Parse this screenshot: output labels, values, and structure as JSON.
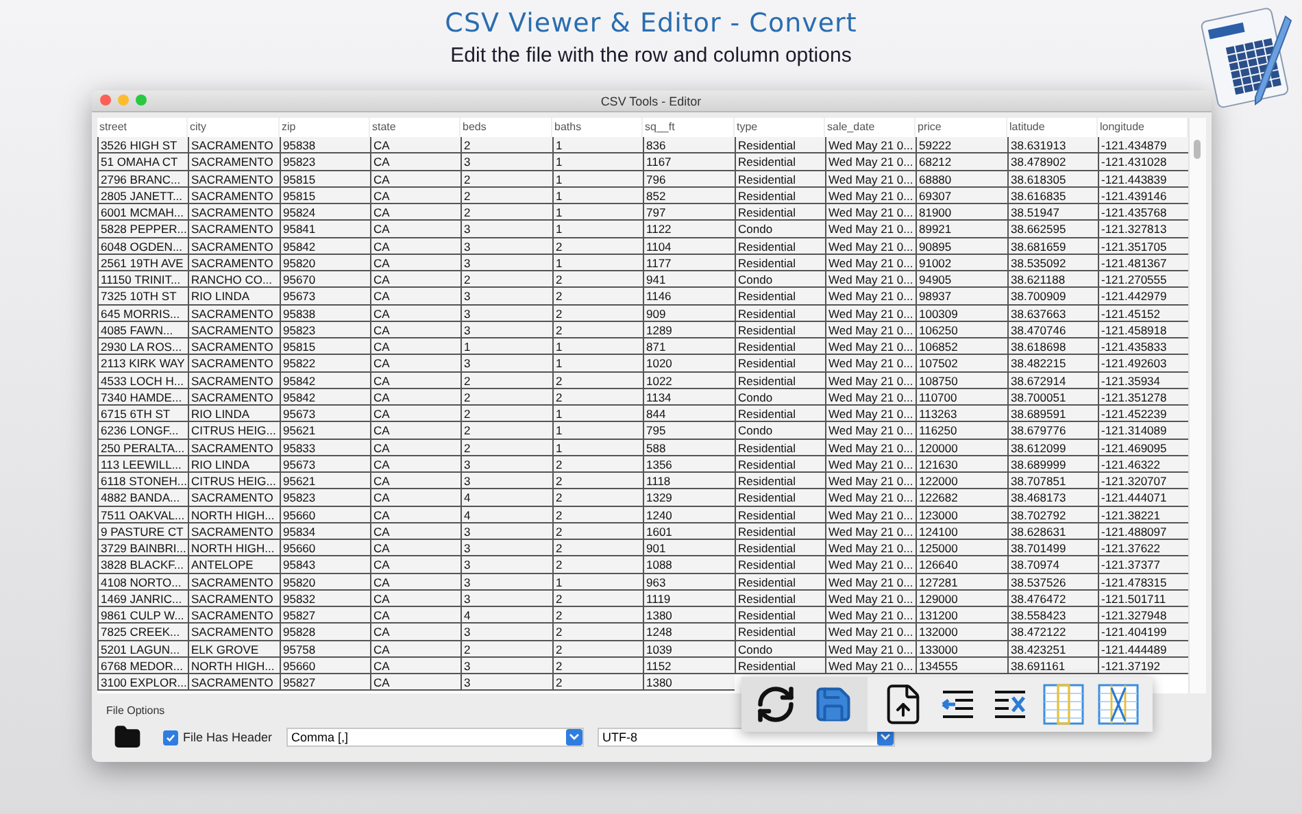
{
  "banner": {
    "title": "CSV Viewer & Editor - Convert",
    "subtitle": "Edit the file with the row and column options"
  },
  "window": {
    "title": "CSV Tools - Editor"
  },
  "table": {
    "columns": [
      "street",
      "city",
      "zip",
      "state",
      "beds",
      "baths",
      "sq__ft",
      "type",
      "sale_date",
      "price",
      "latitude",
      "longitude"
    ],
    "rows": [
      [
        "3526 HIGH ST",
        "SACRAMENTO",
        "95838",
        "CA",
        "2",
        "1",
        "836",
        "Residential",
        "Wed May 21 0...",
        "59222",
        "38.631913",
        "-121.434879"
      ],
      [
        "51 OMAHA CT",
        "SACRAMENTO",
        "95823",
        "CA",
        "3",
        "1",
        "1167",
        "Residential",
        "Wed May 21 0...",
        "68212",
        "38.478902",
        "-121.431028"
      ],
      [
        "2796 BRANC...",
        "SACRAMENTO",
        "95815",
        "CA",
        "2",
        "1",
        "796",
        "Residential",
        "Wed May 21 0...",
        "68880",
        "38.618305",
        "-121.443839"
      ],
      [
        "2805 JANETT...",
        "SACRAMENTO",
        "95815",
        "CA",
        "2",
        "1",
        "852",
        "Residential",
        "Wed May 21 0...",
        "69307",
        "38.616835",
        "-121.439146"
      ],
      [
        "6001 MCMAH...",
        "SACRAMENTO",
        "95824",
        "CA",
        "2",
        "1",
        "797",
        "Residential",
        "Wed May 21 0...",
        "81900",
        "38.51947",
        "-121.435768"
      ],
      [
        "5828 PEPPER...",
        "SACRAMENTO",
        "95841",
        "CA",
        "3",
        "1",
        "1122",
        "Condo",
        "Wed May 21 0...",
        "89921",
        "38.662595",
        "-121.327813"
      ],
      [
        "6048 OGDEN...",
        "SACRAMENTO",
        "95842",
        "CA",
        "3",
        "2",
        "1104",
        "Residential",
        "Wed May 21 0...",
        "90895",
        "38.681659",
        "-121.351705"
      ],
      [
        "2561 19TH AVE",
        "SACRAMENTO",
        "95820",
        "CA",
        "3",
        "1",
        "1177",
        "Residential",
        "Wed May 21 0...",
        "91002",
        "38.535092",
        "-121.481367"
      ],
      [
        "11150 TRINIT...",
        "RANCHO CO...",
        "95670",
        "CA",
        "2",
        "2",
        "941",
        "Condo",
        "Wed May 21 0...",
        "94905",
        "38.621188",
        "-121.270555"
      ],
      [
        "7325 10TH ST",
        "RIO LINDA",
        "95673",
        "CA",
        "3",
        "2",
        "1146",
        "Residential",
        "Wed May 21 0...",
        "98937",
        "38.700909",
        "-121.442979"
      ],
      [
        "645 MORRIS...",
        "SACRAMENTO",
        "95838",
        "CA",
        "3",
        "2",
        "909",
        "Residential",
        "Wed May 21 0...",
        "100309",
        "38.637663",
        "-121.45152"
      ],
      [
        "4085 FAWN...",
        "SACRAMENTO",
        "95823",
        "CA",
        "3",
        "2",
        "1289",
        "Residential",
        "Wed May 21 0...",
        "106250",
        "38.470746",
        "-121.458918"
      ],
      [
        "2930 LA ROS...",
        "SACRAMENTO",
        "95815",
        "CA",
        "1",
        "1",
        "871",
        "Residential",
        "Wed May 21 0...",
        "106852",
        "38.618698",
        "-121.435833"
      ],
      [
        "2113 KIRK WAY",
        "SACRAMENTO",
        "95822",
        "CA",
        "3",
        "1",
        "1020",
        "Residential",
        "Wed May 21 0...",
        "107502",
        "38.482215",
        "-121.492603"
      ],
      [
        "4533 LOCH H...",
        "SACRAMENTO",
        "95842",
        "CA",
        "2",
        "2",
        "1022",
        "Residential",
        "Wed May 21 0...",
        "108750",
        "38.672914",
        "-121.35934"
      ],
      [
        "7340 HAMDE...",
        "SACRAMENTO",
        "95842",
        "CA",
        "2",
        "2",
        "1134",
        "Condo",
        "Wed May 21 0...",
        "110700",
        "38.700051",
        "-121.351278"
      ],
      [
        "6715 6TH ST",
        "RIO LINDA",
        "95673",
        "CA",
        "2",
        "1",
        "844",
        "Residential",
        "Wed May 21 0...",
        "113263",
        "38.689591",
        "-121.452239"
      ],
      [
        "6236 LONGF...",
        "CITRUS HEIG...",
        "95621",
        "CA",
        "2",
        "1",
        "795",
        "Condo",
        "Wed May 21 0...",
        "116250",
        "38.679776",
        "-121.314089"
      ],
      [
        "250 PERALTA...",
        "SACRAMENTO",
        "95833",
        "CA",
        "2",
        "1",
        "588",
        "Residential",
        "Wed May 21 0...",
        "120000",
        "38.612099",
        "-121.469095"
      ],
      [
        "113 LEEWILL...",
        "RIO LINDA",
        "95673",
        "CA",
        "3",
        "2",
        "1356",
        "Residential",
        "Wed May 21 0...",
        "121630",
        "38.689999",
        "-121.46322"
      ],
      [
        "6118 STONEH...",
        "CITRUS HEIG...",
        "95621",
        "CA",
        "3",
        "2",
        "1118",
        "Residential",
        "Wed May 21 0...",
        "122000",
        "38.707851",
        "-121.320707"
      ],
      [
        "4882 BANDA...",
        "SACRAMENTO",
        "95823",
        "CA",
        "4",
        "2",
        "1329",
        "Residential",
        "Wed May 21 0...",
        "122682",
        "38.468173",
        "-121.444071"
      ],
      [
        "7511 OAKVAL...",
        "NORTH HIGH...",
        "95660",
        "CA",
        "4",
        "2",
        "1240",
        "Residential",
        "Wed May 21 0...",
        "123000",
        "38.702792",
        "-121.38221"
      ],
      [
        "9 PASTURE CT",
        "SACRAMENTO",
        "95834",
        "CA",
        "3",
        "2",
        "1601",
        "Residential",
        "Wed May 21 0...",
        "124100",
        "38.628631",
        "-121.488097"
      ],
      [
        "3729 BAINBRI...",
        "NORTH HIGH...",
        "95660",
        "CA",
        "3",
        "2",
        "901",
        "Residential",
        "Wed May 21 0...",
        "125000",
        "38.701499",
        "-121.37622"
      ],
      [
        "3828 BLACKF...",
        "ANTELOPE",
        "95843",
        "CA",
        "3",
        "2",
        "1088",
        "Residential",
        "Wed May 21 0...",
        "126640",
        "38.70974",
        "-121.37377"
      ],
      [
        "4108 NORTO...",
        "SACRAMENTO",
        "95820",
        "CA",
        "3",
        "1",
        "963",
        "Residential",
        "Wed May 21 0...",
        "127281",
        "38.537526",
        "-121.478315"
      ],
      [
        "1469 JANRIC...",
        "SACRAMENTO",
        "95832",
        "CA",
        "3",
        "2",
        "1119",
        "Residential",
        "Wed May 21 0...",
        "129000",
        "38.476472",
        "-121.501711"
      ],
      [
        "9861 CULP W...",
        "SACRAMENTO",
        "95827",
        "CA",
        "4",
        "2",
        "1380",
        "Residential",
        "Wed May 21 0...",
        "131200",
        "38.558423",
        "-121.327948"
      ],
      [
        "7825 CREEK...",
        "SACRAMENTO",
        "95828",
        "CA",
        "3",
        "2",
        "1248",
        "Residential",
        "Wed May 21 0...",
        "132000",
        "38.472122",
        "-121.404199"
      ],
      [
        "5201 LAGUN...",
        "ELK GROVE",
        "95758",
        "CA",
        "2",
        "2",
        "1039",
        "Condo",
        "Wed May 21 0...",
        "133000",
        "38.423251",
        "-121.444489"
      ],
      [
        "6768 MEDOR...",
        "NORTH HIGH...",
        "95660",
        "CA",
        "3",
        "2",
        "1152",
        "Residential",
        "Wed May 21 0...",
        "134555",
        "38.691161",
        "-121.37192"
      ],
      [
        "3100 EXPLOR...",
        "SACRAMENTO",
        "95827",
        "CA",
        "3",
        "2",
        "1380"
      ]
    ]
  },
  "file_options": {
    "label": "File Options",
    "has_header": {
      "label": "File Has Header",
      "checked": true
    },
    "delimiter": "Comma [,]",
    "encoding": "UTF-8"
  }
}
